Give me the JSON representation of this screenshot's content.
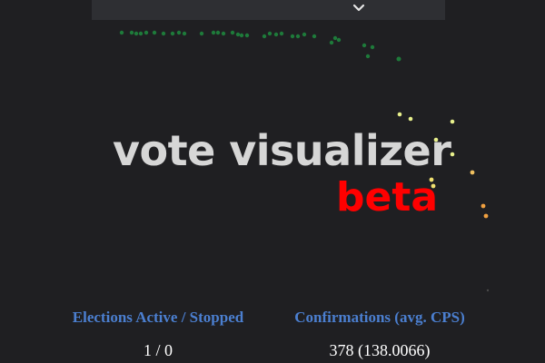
{
  "header": {
    "chevron_icon": "chevron-down-icon"
  },
  "logo": {
    "title": "vote visualizer",
    "badge": "beta",
    "title_color": "#d6d6d6",
    "badge_color": "#ff0000"
  },
  "stats": {
    "elections_label": "Elections Active / Stopped",
    "elections_value": "1 / 0",
    "confirmations_label": "Confirmations (avg. CPS)",
    "confirmations_value": "378 (138.0066)",
    "label_color": "#4b7fd0"
  },
  "colors": {
    "background": "#1f1f22",
    "panel": "#2e2f33",
    "dot_green": "#1e7a3a",
    "dot_yellow": "#e8f08c",
    "dot_orange": "#f0a040"
  }
}
